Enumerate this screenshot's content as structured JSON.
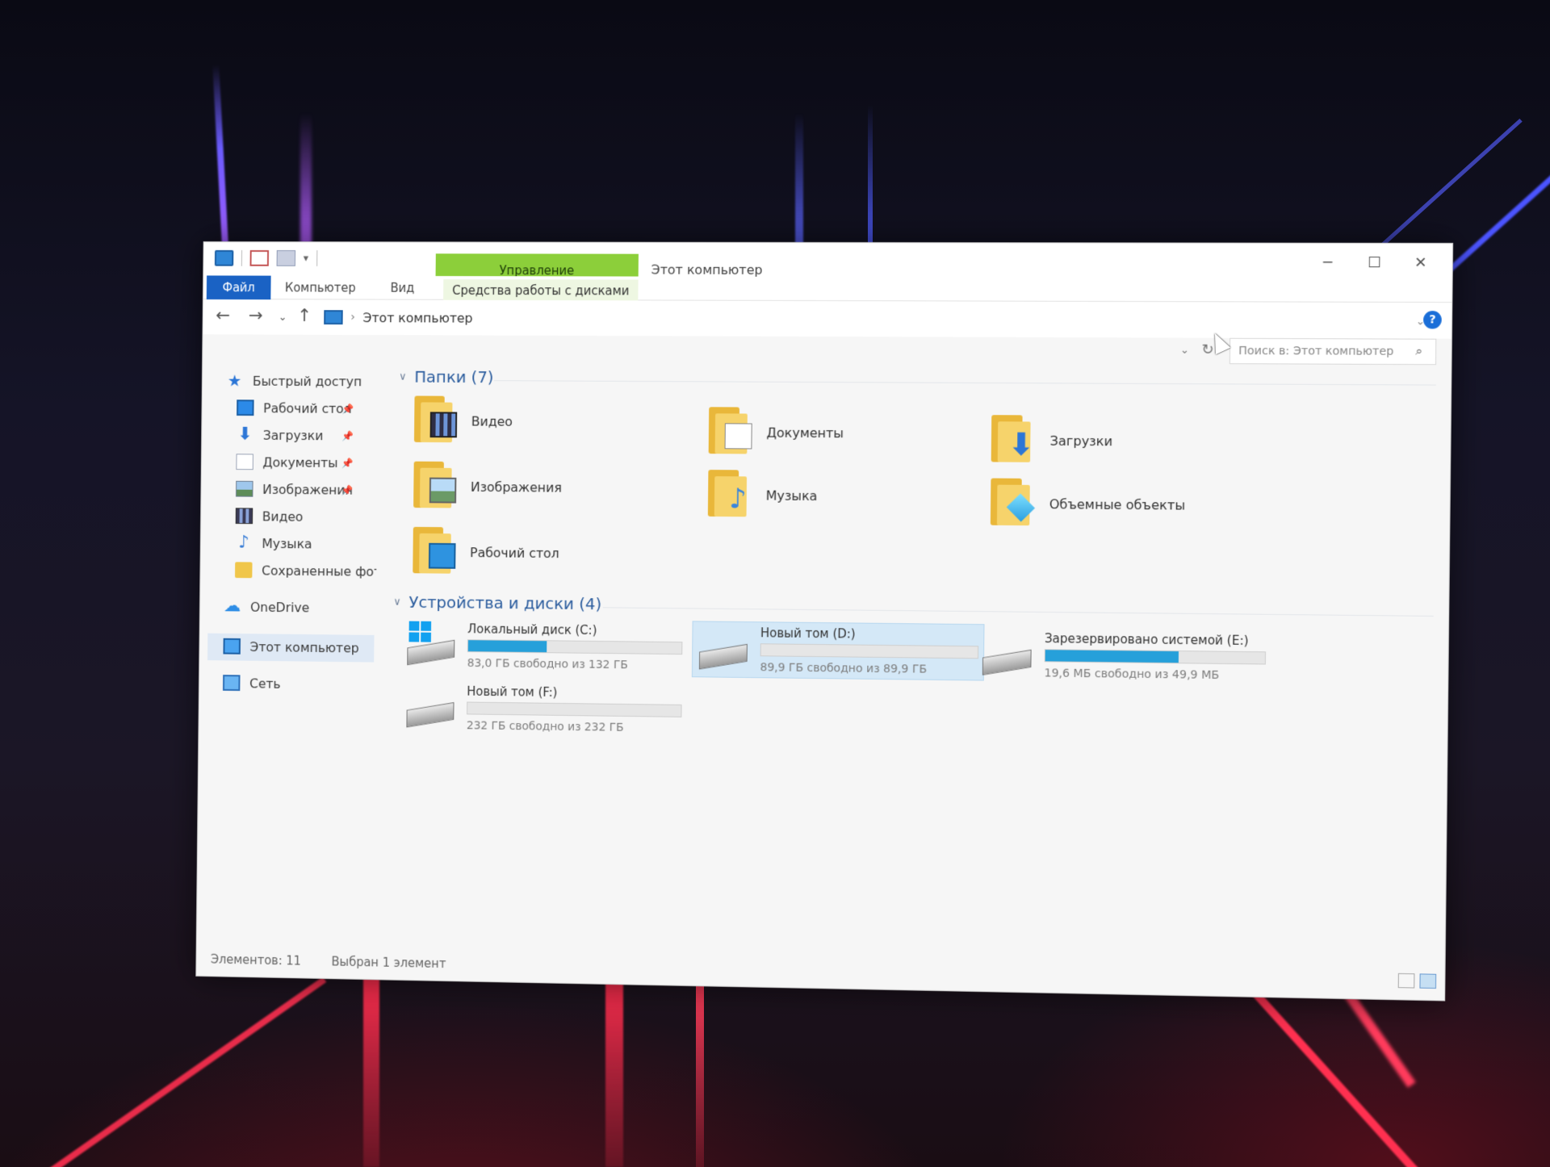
{
  "window": {
    "title": "Этот компьютер",
    "manage_tab": "Управление",
    "controls": {
      "minimize": "─",
      "maximize": "☐",
      "close": "✕"
    }
  },
  "ribbon": {
    "file": "Файл",
    "computer": "Компьютер",
    "view": "Вид",
    "disk_tools": "Средства работы с дисками"
  },
  "address": {
    "separator": "›",
    "path": "Этот компьютер",
    "search_placeholder": "Поиск в: Этот компьютер"
  },
  "nav": {
    "quick_access": "Быстрый доступ",
    "items": [
      {
        "label": "Рабочий стол",
        "icon": "desktop-icon",
        "pinned": true
      },
      {
        "label": "Загрузки",
        "icon": "downloads-icon",
        "pinned": true
      },
      {
        "label": "Документы",
        "icon": "documents-icon",
        "pinned": true
      },
      {
        "label": "Изображения",
        "icon": "pictures-icon",
        "pinned": true
      },
      {
        "label": "Видео",
        "icon": "video-icon",
        "pinned": false
      },
      {
        "label": "Музыка",
        "icon": "music-icon",
        "pinned": false
      },
      {
        "label": "Сохраненные фото",
        "icon": "folder-icon",
        "pinned": false
      }
    ],
    "onedrive": "OneDrive",
    "this_pc": "Этот компьютер",
    "network": "Сеть"
  },
  "folders": {
    "header": "Папки (7)",
    "items": [
      {
        "label": "Видео",
        "icon": "video-folder-icon"
      },
      {
        "label": "Документы",
        "icon": "documents-folder-icon"
      },
      {
        "label": "Загрузки",
        "icon": "downloads-folder-icon"
      },
      {
        "label": "Изображения",
        "icon": "pictures-folder-icon"
      },
      {
        "label": "Музыка",
        "icon": "music-folder-icon"
      },
      {
        "label": "Объемные объекты",
        "icon": "3d-objects-folder-icon"
      },
      {
        "label": "Рабочий стол",
        "icon": "desktop-folder-icon"
      }
    ]
  },
  "devices": {
    "header": "Устройства и диски (4)",
    "drives": [
      {
        "name": "Локальный диск (C:)",
        "space": "83,0 ГБ свободно из 132 ГБ",
        "used_fraction": 0.37,
        "system": true,
        "selected": false
      },
      {
        "name": "Новый том (D:)",
        "space": "89,9 ГБ свободно из 89,9 ГБ",
        "used_fraction": 0.0,
        "system": false,
        "selected": true
      },
      {
        "name": "Зарезервировано системой (E:)",
        "space": "19,6 МБ свободно из 49,9 МБ",
        "used_fraction": 0.61,
        "system": false,
        "selected": false
      },
      {
        "name": "Новый том (F:)",
        "space": "232 ГБ свободно из 232 ГБ",
        "used_fraction": 0.0,
        "system": false,
        "selected": false
      }
    ]
  },
  "status": {
    "count": "Элементов: 11",
    "selection": "Выбран 1 элемент"
  },
  "colors": {
    "accent": "#1a62c4",
    "manage_tab": "#8ccf3a",
    "drive_bar": "#26a0da",
    "selection": "#d4e8f7"
  }
}
